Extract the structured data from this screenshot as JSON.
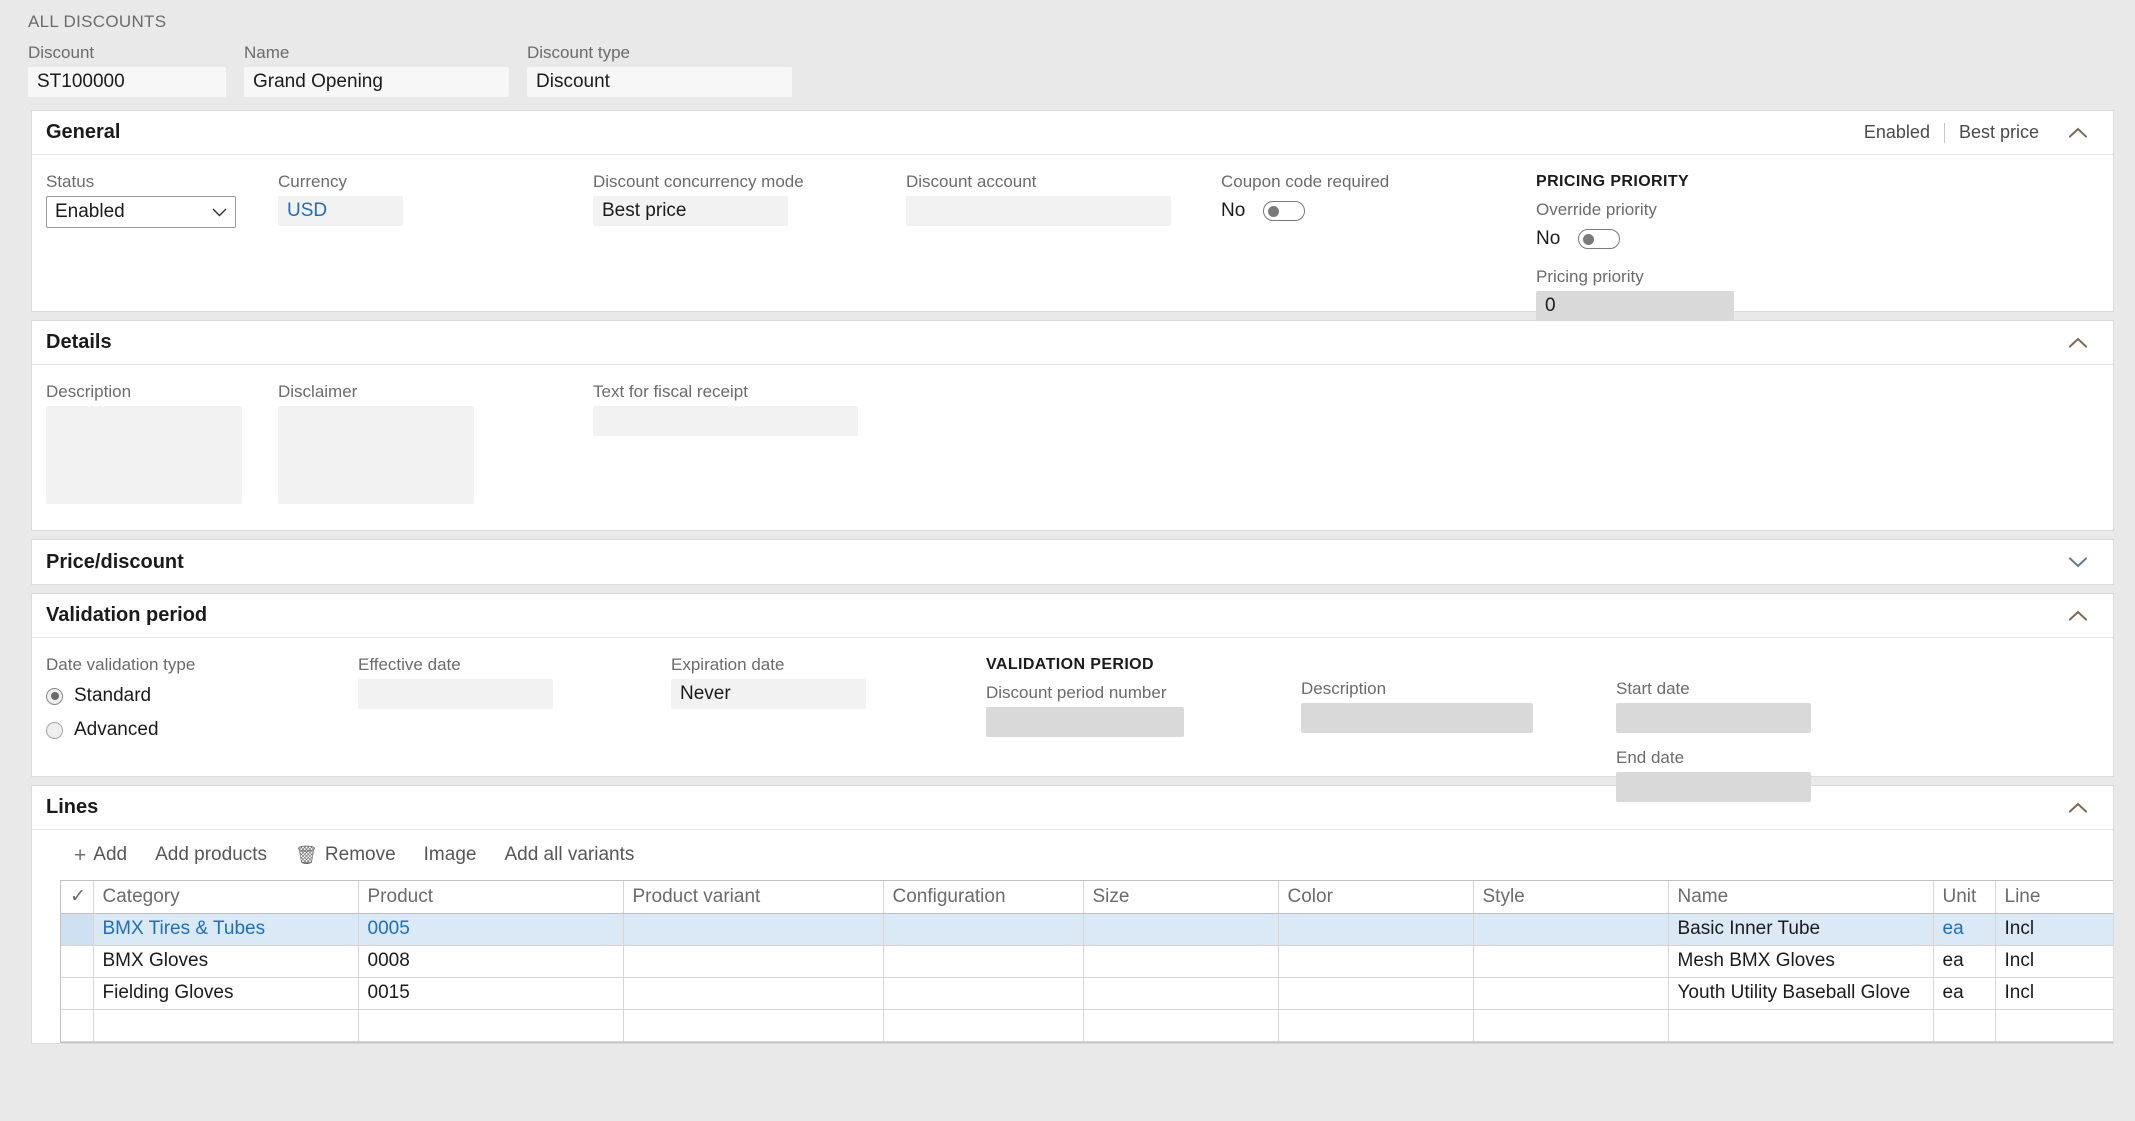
{
  "breadcrumb": "ALL DISCOUNTS",
  "header_fields": [
    {
      "label": "Discount",
      "value": "ST100000"
    },
    {
      "label": "Name",
      "value": "Grand Opening"
    },
    {
      "label": "Discount type",
      "value": "Discount"
    }
  ],
  "general": {
    "title": "General",
    "summary_status": "Enabled",
    "summary_mode": "Best price",
    "collapse_icon": "chevron-up-icon",
    "status": {
      "label": "Status",
      "value": "Enabled"
    },
    "currency": {
      "label": "Currency",
      "value": "USD"
    },
    "concurrency": {
      "label": "Discount concurrency mode",
      "value": "Best price"
    },
    "discount_account": {
      "label": "Discount account",
      "value": ""
    },
    "coupon": {
      "label": "Coupon code required",
      "value": "No"
    },
    "pricing_priority_section": "PRICING PRIORITY",
    "override_priority": {
      "label": "Override priority",
      "value": "No"
    },
    "pricing_priority": {
      "label": "Pricing priority",
      "value": "0"
    }
  },
  "details": {
    "title": "Details",
    "collapse_icon": "chevron-up-icon",
    "description": {
      "label": "Description",
      "value": ""
    },
    "disclaimer": {
      "label": "Disclaimer",
      "value": ""
    },
    "fiscal_receipt": {
      "label": "Text for fiscal receipt",
      "value": ""
    }
  },
  "price_discount": {
    "title": "Price/discount",
    "collapse_icon": "chevron-down-icon"
  },
  "validation_period": {
    "title": "Validation period",
    "collapse_icon": "chevron-up-icon",
    "date_validation_type": {
      "label": "Date validation type",
      "options": [
        "Standard",
        "Advanced"
      ],
      "selected": "Standard"
    },
    "effective_date": {
      "label": "Effective date",
      "value": ""
    },
    "expiration_date": {
      "label": "Expiration date",
      "value": "Never"
    },
    "section_label": "VALIDATION PERIOD",
    "discount_period_number": {
      "label": "Discount period number",
      "value": ""
    },
    "description": {
      "label": "Description",
      "value": ""
    },
    "start_date": {
      "label": "Start date",
      "value": ""
    },
    "end_date": {
      "label": "End date",
      "value": ""
    }
  },
  "lines": {
    "title": "Lines",
    "collapse_icon": "chevron-up-icon",
    "toolbar": [
      {
        "icon": "plus-icon",
        "glyph": "+",
        "label": "Add"
      },
      {
        "icon": "",
        "glyph": "",
        "label": "Add products"
      },
      {
        "icon": "trash-icon",
        "glyph": "🗑",
        "label": "Remove"
      },
      {
        "icon": "",
        "glyph": "",
        "label": "Image"
      },
      {
        "icon": "",
        "glyph": "",
        "label": "Add all variants"
      }
    ],
    "columns": [
      "Category",
      "Product",
      "Product variant",
      "Configuration",
      "Size",
      "Color",
      "Style",
      "Name",
      "Unit",
      "Line"
    ],
    "select_all_icon": "checkmark-icon",
    "rows": [
      {
        "selected": true,
        "category": "BMX Tires & Tubes",
        "product": "0005",
        "variant": "",
        "configuration": "",
        "size": "",
        "color": "",
        "style": "",
        "name": "Basic Inner Tube",
        "unit": "ea",
        "line": "Incl"
      },
      {
        "selected": false,
        "category": "BMX Gloves",
        "product": "0008",
        "variant": "",
        "configuration": "",
        "size": "",
        "color": "",
        "style": "",
        "name": "Mesh BMX Gloves",
        "unit": "ea",
        "line": "Incl"
      },
      {
        "selected": false,
        "category": "Fielding Gloves",
        "product": "0015",
        "variant": "",
        "configuration": "",
        "size": "",
        "color": "",
        "style": "",
        "name": "Youth Utility Baseball Glove",
        "unit": "ea",
        "line": "Incl"
      },
      {
        "selected": false,
        "category": "",
        "product": "",
        "variant": "",
        "configuration": "",
        "size": "",
        "color": "",
        "style": "",
        "name": "",
        "unit": "",
        "line": ""
      }
    ]
  },
  "colors": {
    "accent_link": "#1b6ec2",
    "selected_row": "#dbe9f7",
    "page_bg": "#e9e9e9",
    "field_bg": "#f2f2f2",
    "field_bg_grey": "#d9d9d9"
  }
}
